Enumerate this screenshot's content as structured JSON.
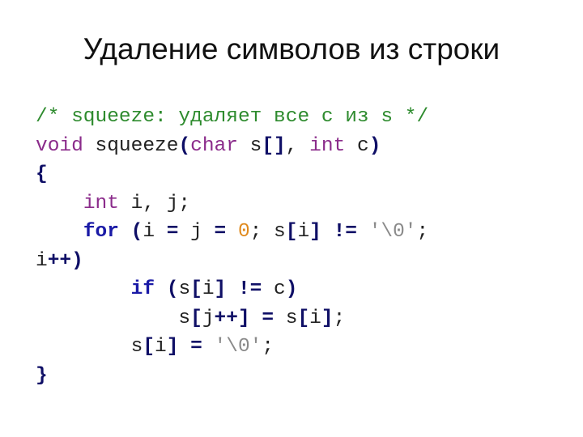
{
  "slide": {
    "title": "Удаление символов из строки"
  },
  "colors": {
    "comment": "#2e8b2e",
    "type": "#8b2c8b",
    "keyword": "#1a1aa6",
    "punct": "#0f0f66",
    "number": "#e08a1e",
    "string": "#8a8a8a",
    "plain": "#222222"
  },
  "code": {
    "lines": [
      [
        {
          "k": "comment",
          "t": "/* squeeze: удаляет все c из s */"
        }
      ],
      [
        {
          "k": "type",
          "t": "void"
        },
        {
          "k": "plain",
          "t": " squeeze"
        },
        {
          "k": "punct",
          "t": "("
        },
        {
          "k": "type",
          "t": "char"
        },
        {
          "k": "plain",
          "t": " s"
        },
        {
          "k": "punct",
          "t": "[]"
        },
        {
          "k": "plain",
          "t": ", "
        },
        {
          "k": "type",
          "t": "int"
        },
        {
          "k": "plain",
          "t": " c"
        },
        {
          "k": "punct",
          "t": ")"
        }
      ],
      [
        {
          "k": "punct",
          "t": "{"
        }
      ],
      [
        {
          "k": "plain",
          "t": "    "
        },
        {
          "k": "type",
          "t": "int"
        },
        {
          "k": "plain",
          "t": " i, j;"
        }
      ],
      [
        {
          "k": "plain",
          "t": "    "
        },
        {
          "k": "keyword",
          "t": "for"
        },
        {
          "k": "plain",
          "t": " "
        },
        {
          "k": "punct",
          "t": "("
        },
        {
          "k": "plain",
          "t": "i "
        },
        {
          "k": "punct",
          "t": "="
        },
        {
          "k": "plain",
          "t": " j "
        },
        {
          "k": "punct",
          "t": "="
        },
        {
          "k": "plain",
          "t": " "
        },
        {
          "k": "number",
          "t": "0"
        },
        {
          "k": "plain",
          "t": "; s"
        },
        {
          "k": "punct",
          "t": "["
        },
        {
          "k": "plain",
          "t": "i"
        },
        {
          "k": "punct",
          "t": "]"
        },
        {
          "k": "plain",
          "t": " "
        },
        {
          "k": "punct",
          "t": "!="
        },
        {
          "k": "plain",
          "t": " "
        },
        {
          "k": "string",
          "t": "'\\0'"
        },
        {
          "k": "plain",
          "t": ";"
        }
      ],
      [
        {
          "k": "plain",
          "t": "i"
        },
        {
          "k": "punct",
          "t": "++)"
        }
      ],
      [
        {
          "k": "plain",
          "t": "        "
        },
        {
          "k": "keyword",
          "t": "if"
        },
        {
          "k": "plain",
          "t": " "
        },
        {
          "k": "punct",
          "t": "("
        },
        {
          "k": "plain",
          "t": "s"
        },
        {
          "k": "punct",
          "t": "["
        },
        {
          "k": "plain",
          "t": "i"
        },
        {
          "k": "punct",
          "t": "]"
        },
        {
          "k": "plain",
          "t": " "
        },
        {
          "k": "punct",
          "t": "!="
        },
        {
          "k": "plain",
          "t": " c"
        },
        {
          "k": "punct",
          "t": ")"
        }
      ],
      [
        {
          "k": "plain",
          "t": "            s"
        },
        {
          "k": "punct",
          "t": "["
        },
        {
          "k": "plain",
          "t": "j"
        },
        {
          "k": "punct",
          "t": "++]"
        },
        {
          "k": "plain",
          "t": " "
        },
        {
          "k": "punct",
          "t": "="
        },
        {
          "k": "plain",
          "t": " s"
        },
        {
          "k": "punct",
          "t": "["
        },
        {
          "k": "plain",
          "t": "i"
        },
        {
          "k": "punct",
          "t": "]"
        },
        {
          "k": "plain",
          "t": ";"
        }
      ],
      [
        {
          "k": "plain",
          "t": "        s"
        },
        {
          "k": "punct",
          "t": "["
        },
        {
          "k": "plain",
          "t": "i"
        },
        {
          "k": "punct",
          "t": "]"
        },
        {
          "k": "plain",
          "t": " "
        },
        {
          "k": "punct",
          "t": "="
        },
        {
          "k": "plain",
          "t": " "
        },
        {
          "k": "string",
          "t": "'\\0'"
        },
        {
          "k": "plain",
          "t": ";"
        }
      ],
      [
        {
          "k": "punct",
          "t": "}"
        }
      ]
    ]
  }
}
